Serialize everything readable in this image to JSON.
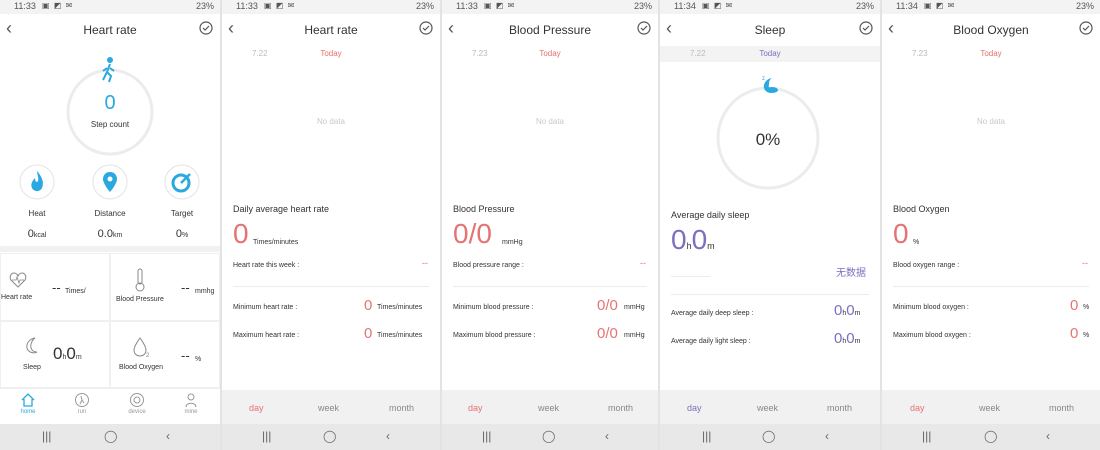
{
  "status": {
    "time_1": "11:33",
    "time_2": "11:33",
    "time_3": "11:33",
    "time_4": "11:34",
    "time_5": "11:34",
    "battery": "23%"
  },
  "panel1": {
    "title": "Heart rate",
    "steps_value": "0",
    "steps_label": "Step count",
    "heat_label": "Heat",
    "heat_value": "0",
    "heat_unit": "kcal",
    "distance_label": "Distance",
    "distance_value": "0.0",
    "distance_unit": "km",
    "target_label": "Target",
    "target_value": "0",
    "target_unit": "%",
    "hr_card_label": "Heart rate",
    "hr_card_value": "--",
    "hr_card_unit": "Times/",
    "bp_card_label": "Blood Pressure",
    "bp_card_value": "--",
    "bp_card_unit": "mmhg",
    "sleep_card_label": "Sleep",
    "sleep_h": "0",
    "sleep_h_unit": "h",
    "sleep_m": "0",
    "sleep_m_unit": "m",
    "ox_card_label": "Blood Oxygen",
    "ox_card_value": "--",
    "ox_card_unit": "%",
    "tabs": [
      "home",
      "run",
      "device",
      "mine"
    ]
  },
  "panel2": {
    "title": "Heart rate",
    "prev_date": "7.22",
    "today": "Today",
    "nodata": "No data",
    "section": "Daily average heart rate",
    "big_value": "0",
    "big_unit": "Times/minutes",
    "week_label": "Heart rate this week :",
    "week_value": "--",
    "min_label": "Minimum heart rate :",
    "min_value": "0",
    "min_unit": "Times/minutes",
    "max_label": "Maximum heart rate :",
    "max_value": "0",
    "max_unit": "Times/minutes"
  },
  "panel3": {
    "title": "Blood Pressure",
    "prev_date": "7.23",
    "today": "Today",
    "nodata": "No data",
    "section": "Blood Pressure",
    "big_value": "0/0",
    "big_unit": "mmHg",
    "range_label": "Blood pressure range :",
    "range_value": "--",
    "min_label": "Minimum blood pressure :",
    "min_value": "0/0",
    "min_unit": "mmHg",
    "max_label": "Maximum blood pressure :",
    "max_value": "0/0",
    "max_unit": "mmHg"
  },
  "panel4": {
    "title": "Sleep",
    "prev_date": "7.22",
    "today": "Today",
    "percent": "0%",
    "section": "Average daily sleep",
    "h_value": "0",
    "h_unit": "h",
    "m_value": "0",
    "m_unit": "m",
    "no_data_cn": "无数据",
    "deep_label": "Average daily deep sleep :",
    "deep_h": "0",
    "deep_m": "0",
    "light_label": "Average daily light sleep :",
    "light_h": "0",
    "light_m": "0",
    "h_small": "h",
    "m_small": "m"
  },
  "panel5": {
    "title": "Blood Oxygen",
    "prev_date": "7.23",
    "today": "Today",
    "nodata": "No data",
    "section": "Blood Oxygen",
    "big_value": "0",
    "big_unit": "%",
    "range_label": "Blood oxygen range :",
    "range_value": "--",
    "min_label": "Minimum blood oxygen :",
    "min_value": "0",
    "min_unit": "%",
    "max_label": "Maximum blood oxygen :",
    "max_value": "0",
    "max_unit": "%"
  },
  "periods": [
    "day",
    "week",
    "month"
  ],
  "colors": {
    "accent_red": "#e57373",
    "accent_blue": "#29a9e0",
    "accent_purple": "#7b6fbf"
  }
}
